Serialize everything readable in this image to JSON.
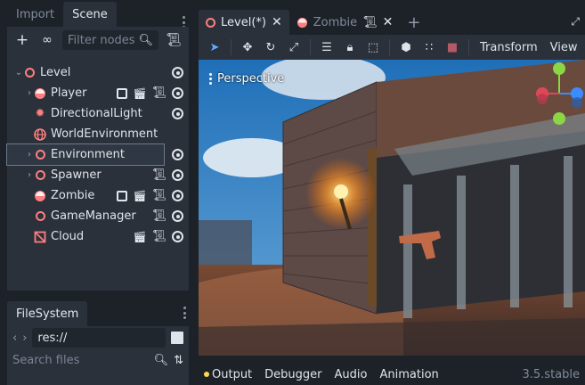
{
  "left_dock": {
    "tabs": [
      {
        "label": "Import"
      },
      {
        "label": "Scene"
      }
    ],
    "filter_placeholder": "Filter nodes",
    "tree": [
      {
        "label": "Level",
        "icon": "node3d-ring-icon",
        "depth": 0,
        "expanded": true
      },
      {
        "label": "Player",
        "icon": "instance-icon",
        "depth": 1
      },
      {
        "label": "DirectionalLight",
        "icon": "light-icon",
        "depth": 1
      },
      {
        "label": "WorldEnvironment",
        "icon": "globe-icon",
        "depth": 1
      },
      {
        "label": "Environment",
        "icon": "node3d-ring-icon",
        "depth": 1,
        "selected": true
      },
      {
        "label": "Spawner",
        "icon": "node3d-ring-icon",
        "depth": 1
      },
      {
        "label": "Zombie",
        "icon": "instance-icon",
        "depth": 1
      },
      {
        "label": "GameManager",
        "icon": "node3d-ring-icon",
        "depth": 1
      },
      {
        "label": "Cloud",
        "icon": "mesh-icon",
        "depth": 1
      }
    ]
  },
  "filesystem": {
    "tab_label": "FileSystem",
    "path": "res://",
    "search_placeholder": "Search files"
  },
  "editor": {
    "scene_tabs": [
      {
        "label": "Level(*)"
      },
      {
        "label": "Zombie"
      }
    ],
    "toolbar": {
      "transform_label": "Transform",
      "view_label": "View"
    },
    "viewport_label": "Perspective"
  },
  "bottom_panel": {
    "tabs": [
      {
        "label": "Output"
      },
      {
        "label": "Debugger"
      },
      {
        "label": "Audio"
      },
      {
        "label": "Animation"
      }
    ],
    "version": "3.5.stable"
  },
  "colors": {
    "accent": "#63a8ff",
    "node3d": "#fc7f7f",
    "gizmo_x": "#e0465a",
    "gizmo_y": "#8bd644",
    "gizmo_z": "#3b8cff"
  }
}
